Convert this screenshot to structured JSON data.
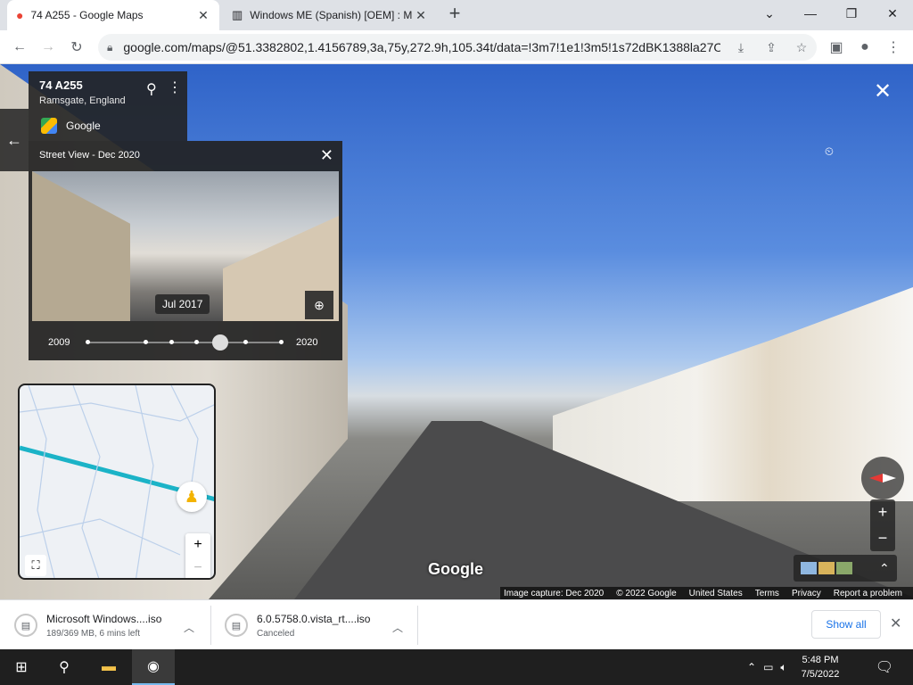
{
  "browser": {
    "tabs": [
      {
        "title": "74 A255 - Google Maps",
        "active": true
      },
      {
        "title": "Windows ME (Spanish) [OEM] : M",
        "active": false
      }
    ],
    "url": "google.com/maps/@51.3382802,1.4156789,3a,75y,272.9h,105.34t/data=!3m7!1e1!3m5!1s72dBK1388la27O..."
  },
  "place": {
    "title": "74 A255",
    "subtitle": "Ramsgate, England",
    "source": "Google"
  },
  "street_view": {
    "header": "Street View - Dec 2020",
    "preview_date": "Jul 2017",
    "timeline_start": "2009",
    "timeline_end": "2020"
  },
  "pano": {
    "watermark": "Google"
  },
  "attribution": {
    "capture": "Image capture: Dec 2020",
    "copyright": "© 2022 Google",
    "region": "United States",
    "terms": "Terms",
    "privacy": "Privacy",
    "report": "Report a problem"
  },
  "downloads": {
    "items": [
      {
        "name": "Microsoft Windows....iso",
        "status": "189/369 MB, 6 mins left"
      },
      {
        "name": "6.0.5758.0.vista_rt....iso",
        "status": "Canceled"
      }
    ],
    "show_all": "Show all"
  },
  "taskbar": {
    "time": "5:48 PM",
    "date": "7/5/2022"
  },
  "colors": {
    "accent": "#1a73e8",
    "taskbar": "#1f1f1f"
  }
}
